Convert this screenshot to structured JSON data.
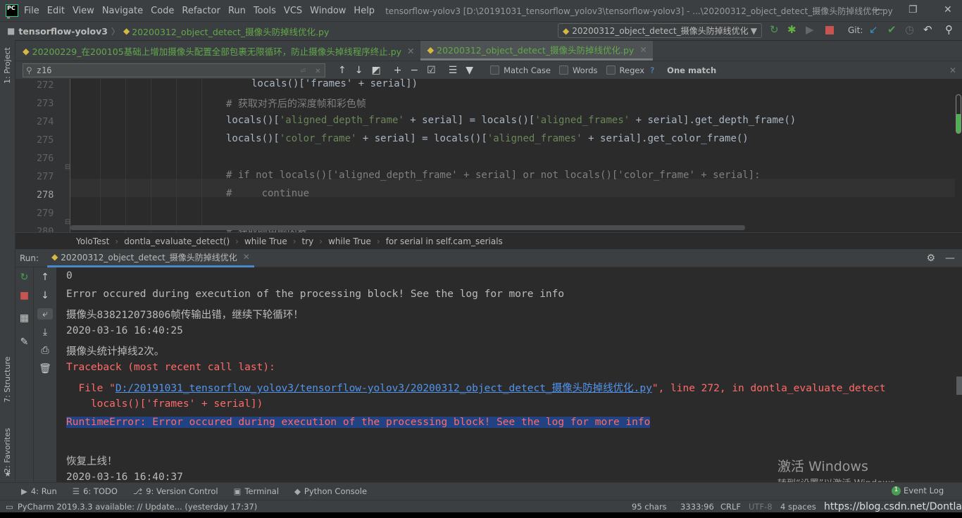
{
  "app": {
    "logo": "PC",
    "window_title": "tensorflow-yolov3 [D:\\20191031_tensorflow_yolov3\\tensorflow-yolov3] - ...\\20200312_object_detect_摄像头防掉线优化.py"
  },
  "menu": [
    "File",
    "Edit",
    "View",
    "Navigate",
    "Code",
    "Refactor",
    "Run",
    "Tools",
    "VCS",
    "Window",
    "Help"
  ],
  "nav": {
    "project": "tensorflow-yolov3",
    "file": "20200312_object_detect_摄像头防掉线优化.py",
    "run_config": "20200312_object_detect_摄像头防掉线优化",
    "git_label": "Git:"
  },
  "tabs": [
    {
      "label": "20200229_在200105基础上增加摄像头配置全部包裹无限循环，防止摄像头掉线程序终止.py",
      "active": false
    },
    {
      "label": "20200312_object_detect_摄像头防掉线优化.py",
      "active": true
    }
  ],
  "find": {
    "query": "z16",
    "match_case": "Match Case",
    "words": "Words",
    "regex": "Regex",
    "help": "?",
    "result": "One match"
  },
  "side": {
    "project": "1: Project",
    "structure": "7: Structure",
    "favorites": "2: Favorites"
  },
  "editor": {
    "current_line": 278,
    "lines": [
      {
        "n": "272",
        "indent": 36,
        "tokens": [
          {
            "t": "code",
            "v": "locals()['frames' + serial])"
          }
        ]
      },
      {
        "n": "273",
        "indent": 0,
        "tokens": [
          {
            "t": "com",
            "v": "# 获取对齐后的深度帧和彩色帧"
          }
        ]
      },
      {
        "n": "274",
        "indent": 0,
        "tokens": [
          {
            "t": "code",
            "v": "locals()["
          },
          {
            "t": "str",
            "v": "'aligned_depth_frame'"
          },
          {
            "t": "code",
            "v": " + serial] = locals()["
          },
          {
            "t": "str",
            "v": "'aligned_frames'"
          },
          {
            "t": "code",
            "v": " + serial].get_depth_frame()"
          }
        ]
      },
      {
        "n": "275",
        "indent": 0,
        "tokens": [
          {
            "t": "code",
            "v": "locals()["
          },
          {
            "t": "str",
            "v": "'color_frame'"
          },
          {
            "t": "code",
            "v": " + serial] = locals()["
          },
          {
            "t": "str",
            "v": "'aligned_frames'"
          },
          {
            "t": "code",
            "v": " + serial].get_color_frame()"
          }
        ]
      },
      {
        "n": "276",
        "indent": 0,
        "tokens": []
      },
      {
        "n": "277",
        "indent": 0,
        "tokens": [
          {
            "t": "com",
            "v": "# if not locals()['aligned_depth_frame' + serial] or not locals()['color_frame' + serial]:"
          }
        ]
      },
      {
        "n": "278",
        "indent": 0,
        "tokens": [
          {
            "t": "com",
            "v": "#     continue"
          }
        ]
      },
      {
        "n": "279",
        "indent": 0,
        "tokens": []
      },
      {
        "n": "280",
        "indent": 0,
        "tokens": [
          {
            "t": "com",
            "v": "# 获取颜色帧内参"
          }
        ]
      }
    ]
  },
  "breadcrumbs": [
    "YoloTest",
    "dontla_evaluate_detect()",
    "while True",
    "try",
    "while True",
    "for serial in self.cam_serials"
  ],
  "run": {
    "label": "Run:",
    "tab": "20200312_object_detect_摄像头防掉线优化"
  },
  "console": [
    {
      "type": "normal",
      "text": "0"
    },
    {
      "type": "normal",
      "text": "Error occured during execution of the processing block! See the log for more info"
    },
    {
      "type": "normal",
      "text": "摄像头838212073806帧传输出错，继续下轮循环！"
    },
    {
      "type": "normal",
      "text": "2020-03-16 16:40:25"
    },
    {
      "type": "normal",
      "text": "摄像头统计掉线2次。"
    },
    {
      "type": "err",
      "text": "Traceback (most recent call last):"
    },
    {
      "type": "file",
      "pre": "  File \"",
      "link": "D:/20191031_tensorflow_yolov3/tensorflow-yolov3/20200312_object_detect_摄像头防掉线优化.py",
      "post": "\", line 272, in dontla_evaluate_detect"
    },
    {
      "type": "err",
      "text": "    locals()['frames' + serial])"
    },
    {
      "type": "sel",
      "text": "RuntimeError: Error occured during execution of the processing block! See the log for more info"
    },
    {
      "type": "normal",
      "text": ""
    },
    {
      "type": "normal",
      "text": "恢复上线！"
    },
    {
      "type": "normal",
      "text": "2020-03-16 16:40:37"
    }
  ],
  "bottom_tabs": [
    {
      "icon": "run-icon",
      "label": "4: Run"
    },
    {
      "icon": "todo-icon",
      "label": "6: TODO"
    },
    {
      "icon": "vcs-icon",
      "label": "9: Version Control"
    },
    {
      "icon": "terminal-icon",
      "label": "Terminal"
    },
    {
      "icon": "python-icon",
      "label": "Python Console"
    }
  ],
  "event_log": {
    "count": "1",
    "label": "Event Log"
  },
  "status": {
    "message": "PyCharm 2019.3.3 available: // Update... (yesterday 17:37)",
    "chars": "95 chars",
    "position": "3333:96",
    "line_sep": "CRLF",
    "encoding": "UTF-8",
    "indent": "4 spaces"
  },
  "watermark": {
    "activate_title": "激活 Windows",
    "activate_sub": "转到“设置”以激活 Windows。",
    "url": "https://blog.csdn.net/Dontla"
  },
  "colors": {
    "accent": "#4a88c7",
    "error": "#ff6b68",
    "link": "#5394ec",
    "selection": "#214283",
    "string": "#6a8759",
    "comment": "#808080"
  }
}
